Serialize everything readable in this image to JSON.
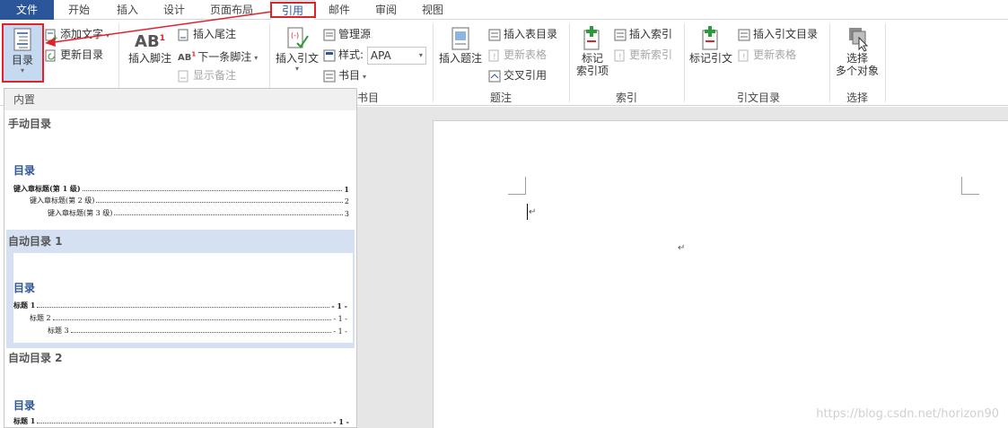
{
  "tabs": [
    {
      "label": "文件"
    },
    {
      "label": "开始"
    },
    {
      "label": "插入"
    },
    {
      "label": "设计"
    },
    {
      "label": "页面布局"
    },
    {
      "label": "引用"
    },
    {
      "label": "邮件"
    },
    {
      "label": "审阅"
    },
    {
      "label": "视图"
    }
  ],
  "ribbon": {
    "toc": {
      "main_label": "目录",
      "add_text": "添加文字",
      "update_toc": "更新目录"
    },
    "footnotes": {
      "insert_footnote": "插入脚注",
      "insert_endnote": "插入尾注",
      "next_footnote": "下一条脚注",
      "show_notes": "显示备注"
    },
    "citations": {
      "insert_citation": "插入引文",
      "manage_sources": "管理源",
      "style_label": "样式:",
      "style_value": "APA",
      "bibliography": "书目",
      "group_label": "书目"
    },
    "captions": {
      "insert_caption": "插入题注",
      "insert_table_of_figures": "插入表目录",
      "update_table": "更新表格",
      "cross_reference": "交叉引用",
      "group_label": "题注"
    },
    "index": {
      "mark_entry_line1": "标记",
      "mark_entry_line2": "索引项",
      "insert_index": "插入索引",
      "update_index": "更新索引",
      "group_label": "索引"
    },
    "toa": {
      "mark_citation": "标记引文",
      "insert_toa": "插入引文目录",
      "update_table": "更新表格",
      "group_label": "引文目录"
    },
    "select": {
      "line1": "选择",
      "line2": "多个对象",
      "group_label": "选择"
    }
  },
  "gallery": {
    "header": "内置",
    "manual": {
      "title": "手动目录",
      "heading": "目录",
      "rows": [
        {
          "text": "键入章标题(第 1 级)",
          "page": "1"
        },
        {
          "text": "键入章标题(第 2 级)",
          "page": "2"
        },
        {
          "text": "键入章标题(第 3 级)",
          "page": "3"
        }
      ]
    },
    "auto1": {
      "title": "自动目录 1",
      "heading": "目录",
      "rows": [
        {
          "text": "标题 1",
          "page": "- 1 -"
        },
        {
          "text": "标题 2",
          "page": "- 1 -"
        },
        {
          "text": "标题 3",
          "page": "- 1 -"
        }
      ]
    },
    "auto2": {
      "title": "自动目录 2",
      "heading": "目录",
      "rows": [
        {
          "text": "标题 1",
          "page": "- 1 -"
        }
      ]
    }
  },
  "document": {
    "paragraph_mark": "↵"
  },
  "watermark": "https://blog.csdn.net/horizon90",
  "colors": {
    "file_tab": "#2b579a",
    "highlight_box": "#e0232b",
    "selected_item": "#d5e1f2",
    "toc_heading": "#2e5597"
  }
}
